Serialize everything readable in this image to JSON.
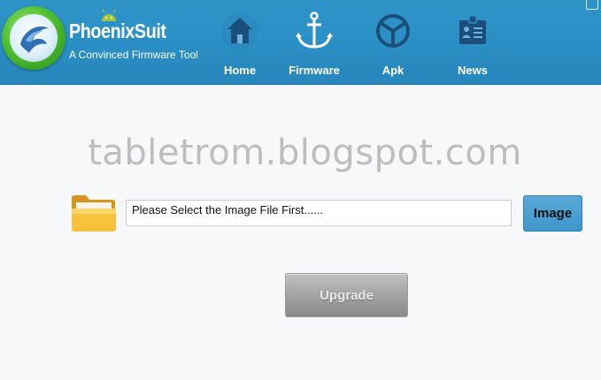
{
  "app": {
    "name": "PhoenixSuit",
    "tagline": "A Convinced Firmware Tool"
  },
  "nav": [
    {
      "label": "Home",
      "icon": "home-icon"
    },
    {
      "label": "Firmware",
      "icon": "anchor-icon"
    },
    {
      "label": "Apk",
      "icon": "apk-icon"
    },
    {
      "label": "News",
      "icon": "news-icon"
    }
  ],
  "watermark": "tabletrom.blogspot.com",
  "firmware": {
    "file_value": "Please Select the Image File First......",
    "image_button": "Image",
    "upgrade_button": "Upgrade"
  },
  "colors": {
    "header_blue": "#2a8fc4",
    "logo_green": "#4fbf2f",
    "image_button": "#3f96cb"
  }
}
